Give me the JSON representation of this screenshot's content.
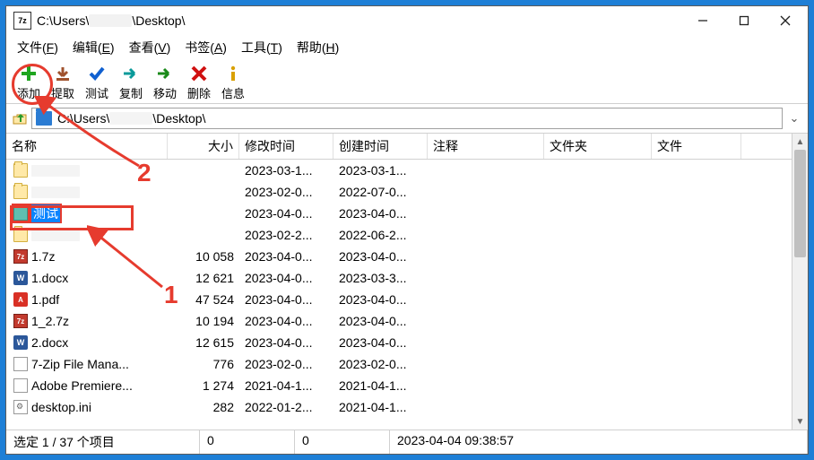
{
  "titlebar": {
    "path_prefix": "C:\\Users\\",
    "path_suffix": "\\Desktop\\"
  },
  "menu": {
    "file": "文件(",
    "file_u": "F",
    "file_e": ")",
    "edit": "编辑(",
    "edit_u": "E",
    "edit_e": ")",
    "view": "查看(",
    "view_u": "V",
    "view_e": ")",
    "bookmark": "书签(",
    "bookmark_u": "A",
    "bookmark_e": ")",
    "tool": "工具(",
    "tool_u": "T",
    "tool_e": ")",
    "help": "帮助(",
    "help_u": "H",
    "help_e": ")"
  },
  "toolbar": {
    "add": "添加",
    "extract": "提取",
    "test": "测试",
    "copy": "复制",
    "move": "移动",
    "delete": "删除",
    "info": "信息"
  },
  "address": {
    "prefix": "C:\\Users\\",
    "suffix": "\\Desktop\\"
  },
  "columns": {
    "name": "名称",
    "size": "大小",
    "mtime": "修改时间",
    "ctime": "创建时间",
    "comment": "注释",
    "folders": "文件夹",
    "files": "文件"
  },
  "rows": [
    {
      "kind": "folder",
      "name": "",
      "obscured": true,
      "size": "",
      "mtime": "2023-03-1...",
      "ctime": "2023-03-1...",
      "selected": false
    },
    {
      "kind": "folder",
      "name": "",
      "obscured": true,
      "size": "",
      "mtime": "2023-02-0...",
      "ctime": "2022-07-0...",
      "selected": false
    },
    {
      "kind": "folder-teal",
      "name": "测试",
      "obscured": false,
      "size": "",
      "mtime": "2023-04-0...",
      "ctime": "2023-04-0...",
      "selected": true
    },
    {
      "kind": "folder",
      "name": "",
      "obscured": true,
      "size": "",
      "mtime": "2023-02-2...",
      "ctime": "2022-06-2...",
      "selected": false
    },
    {
      "kind": "sevenz",
      "name": "1.7z",
      "obscured": false,
      "size": "10 058",
      "mtime": "2023-04-0...",
      "ctime": "2023-04-0...",
      "selected": false
    },
    {
      "kind": "docx",
      "name": "1.docx",
      "obscured": false,
      "size": "12 621",
      "mtime": "2023-04-0...",
      "ctime": "2023-03-3...",
      "selected": false
    },
    {
      "kind": "pdf",
      "name": "1.pdf",
      "obscured": false,
      "size": "47 524",
      "mtime": "2023-04-0...",
      "ctime": "2023-04-0...",
      "selected": false
    },
    {
      "kind": "sevenz",
      "name": "1_2.7z",
      "obscured": false,
      "size": "10 194",
      "mtime": "2023-04-0...",
      "ctime": "2023-04-0...",
      "selected": false
    },
    {
      "kind": "docx",
      "name": "2.docx",
      "obscured": false,
      "size": "12 615",
      "mtime": "2023-04-0...",
      "ctime": "2023-04-0...",
      "selected": false
    },
    {
      "kind": "lnk",
      "name": "7-Zip File Mana...",
      "obscured": false,
      "size": "776",
      "mtime": "2023-02-0...",
      "ctime": "2023-02-0...",
      "selected": false
    },
    {
      "kind": "lnk",
      "name": "Adobe Premiere...",
      "obscured": false,
      "size": "1 274",
      "mtime": "2021-04-1...",
      "ctime": "2021-04-1...",
      "selected": false
    },
    {
      "kind": "ini",
      "name": "desktop.ini",
      "obscured": false,
      "size": "282",
      "mtime": "2022-01-2...",
      "ctime": "2021-04-1...",
      "selected": false
    }
  ],
  "status": {
    "selection": "选定 1 / 37 个项目",
    "s1": "0",
    "s2": "0",
    "s3": "2023-04-04 09:38:57"
  },
  "annotations": {
    "n1": "1",
    "n2": "2"
  }
}
